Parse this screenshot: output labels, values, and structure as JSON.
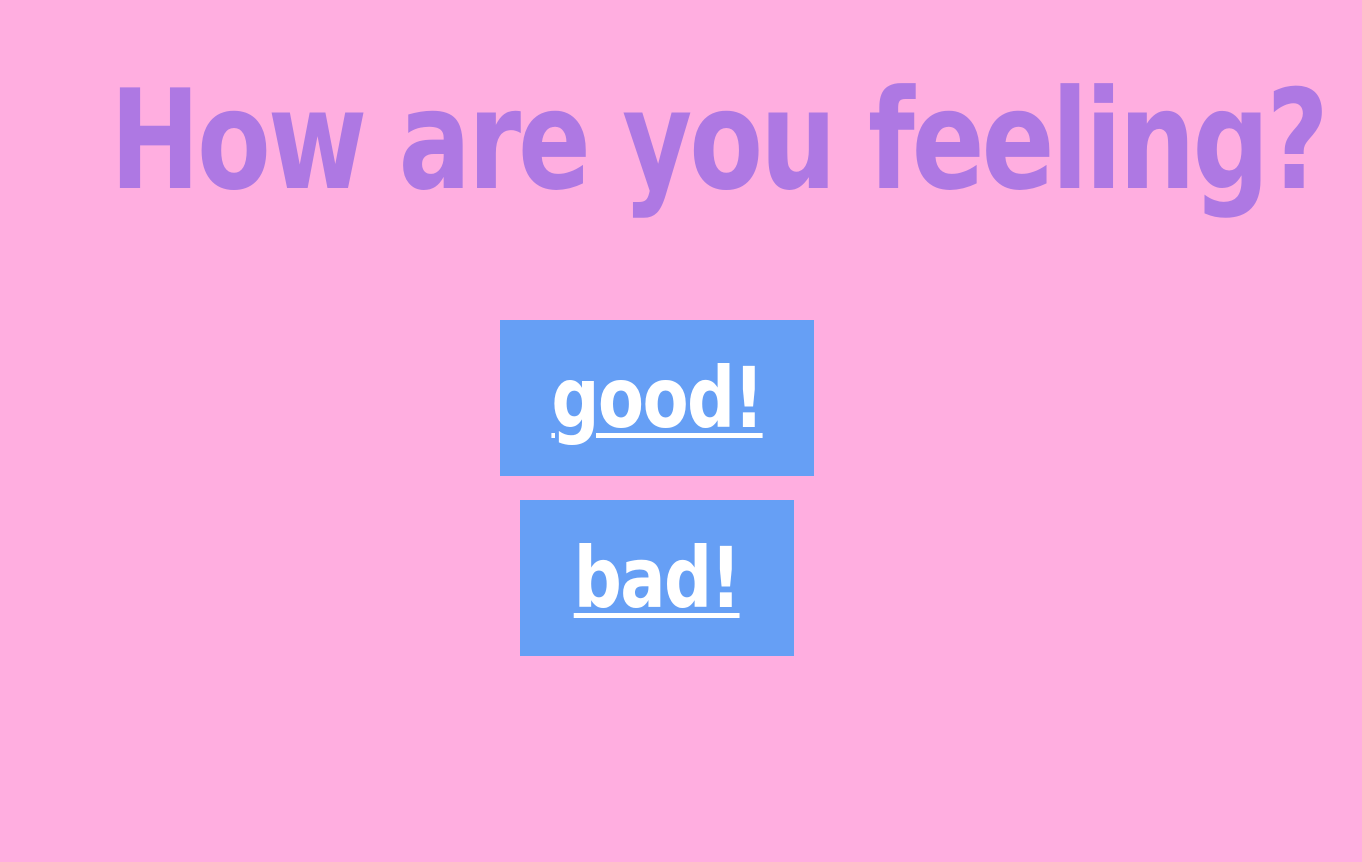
{
  "page": {
    "title": "How are you feeling?"
  },
  "buttons": {
    "good_label": "good!",
    "bad_label": "bad!"
  },
  "colors": {
    "background": "#ffaee0",
    "title": "#ae78e3",
    "button_bg": "#669ff5",
    "button_text": "#ffffff"
  }
}
